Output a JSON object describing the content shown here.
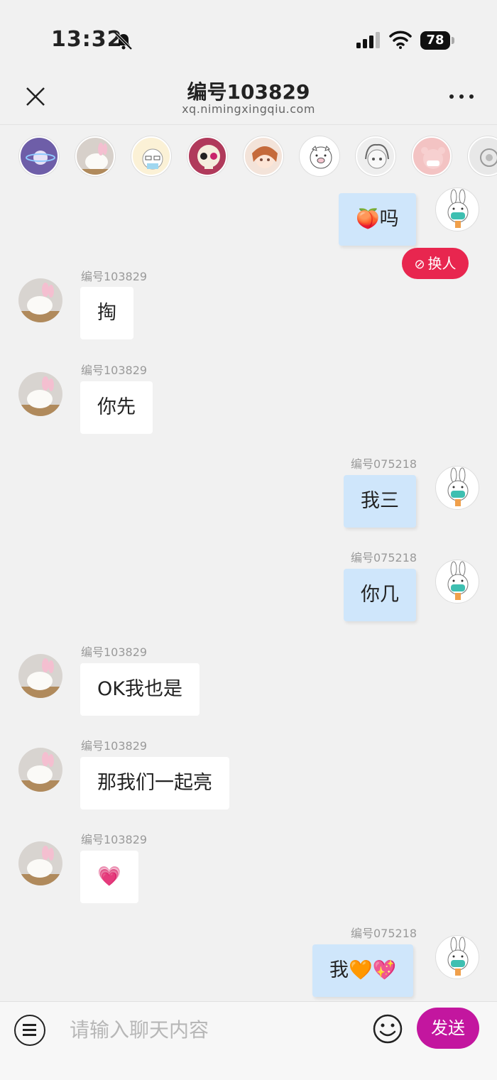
{
  "status_bar": {
    "time": "13:32",
    "battery": "78",
    "icons": [
      "bell-slash-icon",
      "cellular-signal-icon",
      "wifi-icon",
      "battery-icon"
    ]
  },
  "nav": {
    "title": "编号103829",
    "subtitle": "xq.nimingxingqiu.com",
    "close_icon": "close-icon",
    "more_icon": "more-icon"
  },
  "avatar_strip": [
    "planet-avatar",
    "bunny-avatar",
    "doodle-avatar",
    "skull-avatar",
    "anime-girl-avatar",
    "pig-avatar",
    "sketch-girl-avatar",
    "pink-bear-avatar",
    "misc-avatar"
  ],
  "chat": {
    "swap_button": "换人",
    "messages": [
      {
        "side": "right",
        "sender": "",
        "text": "🍑吗"
      },
      {
        "side": "left",
        "sender": "编号103829",
        "text": "掏"
      },
      {
        "side": "left",
        "sender": "编号103829",
        "text": "你先"
      },
      {
        "side": "right",
        "sender": "编号075218",
        "text": "我三"
      },
      {
        "side": "right",
        "sender": "编号075218",
        "text": "你几"
      },
      {
        "side": "left",
        "sender": "编号103829",
        "text": "OK我也是"
      },
      {
        "side": "left",
        "sender": "编号103829",
        "text": "那我们一起亮"
      },
      {
        "side": "left",
        "sender": "编号103829",
        "text": "💗"
      },
      {
        "side": "right",
        "sender": "编号075218",
        "text": "我🧡💖"
      }
    ]
  },
  "input_bar": {
    "placeholder": "请输入聊天内容",
    "send_label": "发送",
    "menu_icon": "menu-icon",
    "emoji_icon": "emoji-icon"
  },
  "colors": {
    "background": "#f1f1f1",
    "my_bubble": "#cfe6fb",
    "their_bubble": "#ffffff",
    "swap_button": "#e8264f",
    "send_button": "#c3169f"
  }
}
